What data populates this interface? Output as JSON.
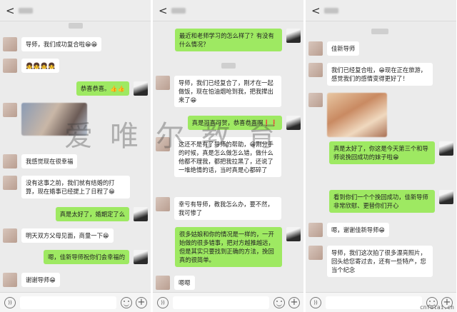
{
  "colors": {
    "outgoing_bubble": "#9ee962",
    "incoming_bubble": "#ffffff",
    "chat_background": "#ebebeb"
  },
  "icons": {
    "back": "chevron-left-icon",
    "voice": "voice-icon",
    "emoji": "emoji-icon",
    "plus": "plus-icon"
  },
  "header": {
    "back_glyph": "<"
  },
  "footer": {
    "voice_glyph": "))",
    "plus_glyph": "+"
  },
  "watermark": "爱唯尔教育",
  "site": "cnfulai.cn",
  "panel1": {
    "m1": "导师，我们成功复合啦😁😁",
    "m2": "👧👧👧👧",
    "m3": "恭喜恭喜。👍👍",
    "m4": "我感觉现在很幸福",
    "m5": "没有这事之前，我们就有结婚的打算，现在婚事已经提上了日程了😁",
    "m6": "真是太好了，婚期定了么",
    "m7": "明天双方父母见面，商量一下😁",
    "m8": "嗯，佳新导师祝你们会幸福的",
    "m9": "谢谢导师😁"
  },
  "panel2": {
    "m1": "最近和老师学习的怎么样了？有没有什么情况？",
    "m2": "导师，我们已经复合了，刚才在一起做饭，现在怕油烟呛到我，把我撵出来了😁",
    "m3": "真是可喜可贺，恭喜恭喜啊❗❗",
    "m4": "这还不是有了导师的帮助，😁刚分手的时候，真是怎么做怎么错，做什么他都不理我，都把我拉黑了，还说了一堆绝情的话，当时真是心都碎了",
    "m5": "幸亏有导师，教我怎么办，要不然，我可惨了",
    "m6": "很多姑娘和你的情况是一样的，一开始做的很多错事，把对方越推越远，但是其实只要找到正确的方法，挽回真的很简单。",
    "m7": "嗯嗯"
  },
  "panel3": {
    "m1": "佳新导师",
    "m2": "我们已经复合啦，😁现在正在旅游，感觉我们的感情变得更好了！",
    "m3": "真是太好了，你这是今天第三个和导师说挽回成功的妹子啦😁",
    "m4": "看到你们一个个挽回成功，佳新导师非常欣慰、更替你们开心",
    "m5": "嗯，谢谢佳新导师😁",
    "m6": "导师，我们这次拍了很多漂亮照片，回头给您寄过去，还有一些特产，您当个纪念"
  }
}
